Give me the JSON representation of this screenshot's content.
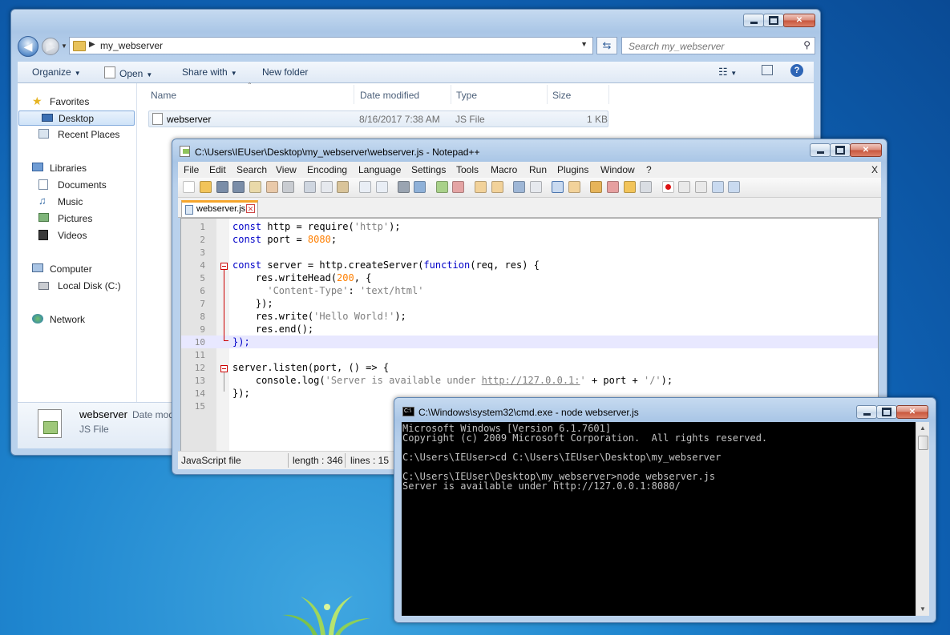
{
  "explorer": {
    "breadcrumb": "my_webserver",
    "search_placeholder": "Search my_webserver",
    "commands": {
      "organize": "Organize",
      "open": "Open",
      "share_with": "Share with",
      "new_folder": "New folder"
    },
    "nav": {
      "favorites": "Favorites",
      "desktop": "Desktop",
      "recent_places": "Recent Places",
      "libraries": "Libraries",
      "documents": "Documents",
      "music": "Music",
      "pictures": "Pictures",
      "videos": "Videos",
      "computer": "Computer",
      "local_disk": "Local Disk (C:)",
      "network": "Network"
    },
    "columns": {
      "name": "Name",
      "date_modified": "Date modified",
      "type": "Type",
      "size": "Size"
    },
    "file": {
      "name": "webserver",
      "date": "8/16/2017 7:38 AM",
      "type": "JS File",
      "size": "1 KB"
    },
    "details": {
      "name": "webserver",
      "date_label": "Date mod",
      "type": "JS File"
    }
  },
  "notepad": {
    "title": "C:\\Users\\IEUser\\Desktop\\my_webserver\\webserver.js - Notepad++",
    "menu": [
      "File",
      "Edit",
      "Search",
      "View",
      "Encoding",
      "Language",
      "Settings",
      "Tools",
      "Macro",
      "Run",
      "Plugins",
      "Window",
      "?"
    ],
    "menu_close": "X",
    "tab_label": "webserver.js",
    "line_numbers": [
      "1",
      "2",
      "3",
      "4",
      "5",
      "6",
      "7",
      "8",
      "9",
      "10",
      "11",
      "12",
      "13",
      "14",
      "15"
    ],
    "code": {
      "l1a": "const",
      "l1b": " http = require(",
      "l1c": "'http'",
      "l1d": ");",
      "l2a": "const",
      "l2b": " port = ",
      "l2c": "8080",
      "l2d": ";",
      "l4a": "const",
      "l4b": " server = http.createServer(",
      "l4c": "function",
      "l4d": "(req, res) {",
      "l5a": "    res.writeHead(",
      "l5b": "200",
      "l5c": ", {",
      "l6a": "      ",
      "l6b": "'Content-Type'",
      "l6c": ": ",
      "l6d": "'text/html'",
      "l7": "    });",
      "l8a": "    res.write(",
      "l8b": "'Hello World!'",
      "l8c": ");",
      "l9": "    res.end();",
      "l10": "});",
      "l12": "server.listen(port, () => {",
      "l13a": "    console.log(",
      "l13b": "'Server is available under ",
      "l13c": "http://127.0.0.1:",
      "l13d": "'",
      "l13e": " + port + ",
      "l13f": "'/'",
      "l13g": ");",
      "l14": "});"
    },
    "status": {
      "filetype": "JavaScript file",
      "length": "length : 346",
      "lines": "lines : 15"
    }
  },
  "cmd": {
    "title": "C:\\Windows\\system32\\cmd.exe - node  webserver.js",
    "icon_text": "C:\\",
    "output": "Microsoft Windows [Version 6.1.7601]\nCopyright (c) 2009 Microsoft Corporation.  All rights reserved.\n\nC:\\Users\\IEUser>cd C:\\Users\\IEUser\\Desktop\\my_webserver\n\nC:\\Users\\IEUser\\Desktop\\my_webserver>node webserver.js\nServer is available under http://127.0.0.1:8080/"
  }
}
